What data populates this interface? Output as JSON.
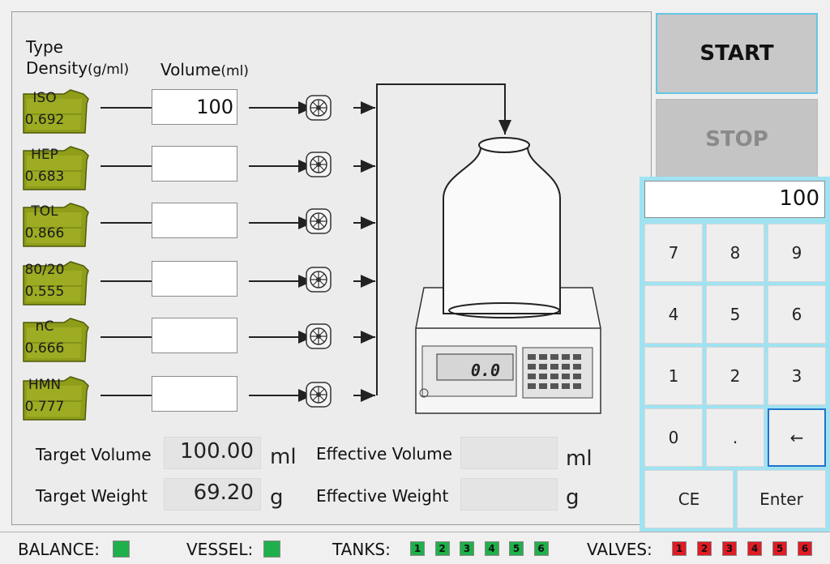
{
  "header": {
    "type_label": "Type",
    "density_label": "Density",
    "density_unit": "(g/ml)",
    "volume_label": "Volume",
    "volume_unit": "(ml)"
  },
  "tanks": [
    {
      "name": "ISO",
      "density": "0.692",
      "volume": "100"
    },
    {
      "name": "HEP",
      "density": "0.683",
      "volume": ""
    },
    {
      "name": "TOL",
      "density": "0.866",
      "volume": ""
    },
    {
      "name": "80/20",
      "density": "0.555",
      "volume": ""
    },
    {
      "name": "nC",
      "density": "0.666",
      "volume": ""
    },
    {
      "name": "HMN",
      "density": "0.777",
      "volume": ""
    }
  ],
  "summary": {
    "target_volume_label": "Target Volume",
    "target_volume_value": "100.00",
    "target_volume_unit": "ml",
    "target_weight_label": "Target Weight",
    "target_weight_value": "69.20",
    "target_weight_unit": "g",
    "effective_volume_label": "Effective Volume",
    "effective_volume_value": "",
    "effective_volume_unit": "ml",
    "effective_weight_label": "Effective Weight",
    "effective_weight_value": "",
    "effective_weight_unit": "g"
  },
  "scale": {
    "display": "0.0"
  },
  "controls": {
    "start_label": "START",
    "stop_label": "STOP"
  },
  "keypad": {
    "display": "100",
    "keys": [
      "7",
      "8",
      "9",
      "4",
      "5",
      "6",
      "1",
      "2",
      "3",
      "0",
      ".",
      "←"
    ],
    "ce_label": "CE",
    "enter_label": "Enter"
  },
  "status": {
    "balance_label": "BALANCE:",
    "vessel_label": "VESSEL:",
    "tanks_label": "TANKS:",
    "valves_label": "VALVES:",
    "tank_leds": [
      "1",
      "2",
      "3",
      "4",
      "5",
      "6"
    ],
    "valve_leds": [
      "1",
      "2",
      "3",
      "4",
      "5",
      "6"
    ],
    "ok_color": "#1fb04b",
    "alarm_color": "#e01b24"
  }
}
